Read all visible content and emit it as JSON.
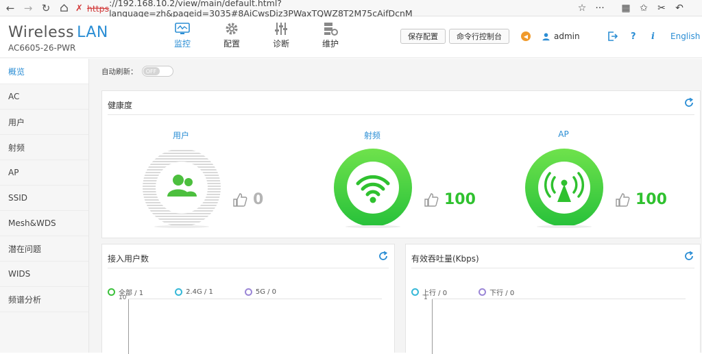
{
  "browser": {
    "url_scheme": "https",
    "url_rest": "://192.168.10.2/view/main/default.html?language=zh&pageid=3035#8AiCwsDiz3PWaxTQWZ8T2M75cAifDcnM",
    "more_label": "···"
  },
  "header": {
    "brand_a": "Wireless",
    "brand_b": "LAN",
    "model": "AC6605-26-PWR",
    "nav": [
      {
        "label": "监控",
        "icon": "monitor-icon"
      },
      {
        "label": "配置",
        "icon": "gear-icon"
      },
      {
        "label": "诊断",
        "icon": "sliders-icon"
      },
      {
        "label": "维护",
        "icon": "maintenance-icon"
      }
    ],
    "save_config": "保存配置",
    "cli_console": "命令行控制台",
    "user": "admin",
    "help": "?",
    "info": "i",
    "language": "English"
  },
  "sidebar": {
    "items": [
      "概览",
      "AC",
      "用户",
      "射频",
      "AP",
      "SSID",
      "Mesh&WDS",
      "潜在问题",
      "WIDS",
      "频谱分析"
    ]
  },
  "content": {
    "auto_refresh_label": "自动刷新：",
    "auto_refresh_state": "OFF",
    "health": {
      "title": "健康度",
      "gauges": [
        {
          "label": "用户",
          "score": "0",
          "level": 0
        },
        {
          "label": "射频",
          "score": "100",
          "level": 100
        },
        {
          "label": "AP",
          "score": "100",
          "level": 100
        }
      ]
    },
    "users_panel": {
      "title": "接入用户数",
      "legend": [
        {
          "label": "全部 / 1",
          "color": "#3cc13c"
        },
        {
          "label": "2.4G / 1",
          "color": "#36b8d8"
        },
        {
          "label": "5G / 0",
          "color": "#9b86d6"
        }
      ],
      "y_max": "10"
    },
    "throughput_panel": {
      "title": "有效吞吐量(Kbps)",
      "legend": [
        {
          "label": "上行 / 0",
          "color": "#36b8d8"
        },
        {
          "label": "下行 / 0",
          "color": "#9b86d6"
        }
      ],
      "y_max": "1"
    }
  },
  "colors": {
    "accent": "#2a8dd4",
    "good": "#2fc12f",
    "inactive": "#b4b4b4"
  }
}
